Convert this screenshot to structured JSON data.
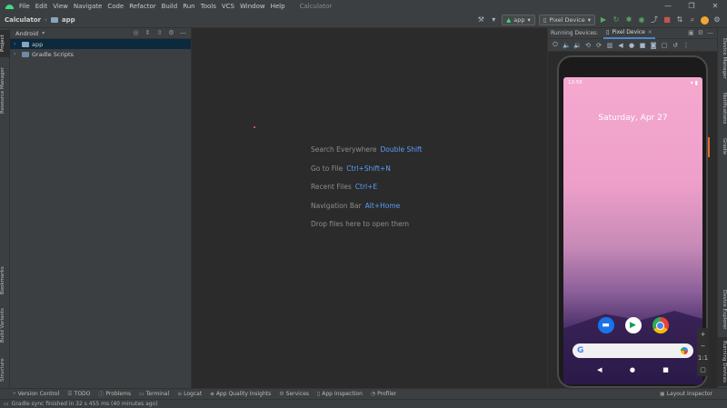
{
  "menu": [
    "File",
    "Edit",
    "View",
    "Navigate",
    "Code",
    "Refactor",
    "Build",
    "Run",
    "Tools",
    "VCS",
    "Window",
    "Help"
  ],
  "window_title": "Calculator",
  "window_controls": [
    "—",
    "❐",
    "✕"
  ],
  "breadcrumb": {
    "project": "Calculator",
    "module": "app"
  },
  "toolbar": {
    "run_config": "app",
    "device": "Pixel Device"
  },
  "project_panel": {
    "view_mode": "Android",
    "tree": [
      {
        "label": "app",
        "selected": true
      },
      {
        "label": "Gradle Scripts",
        "selected": false
      }
    ]
  },
  "left_tabs": [
    "Project",
    "Resource Manager",
    "Bookmarks",
    "Build Variants",
    "Structure"
  ],
  "right_tabs": [
    "Device Manager",
    "Notifications",
    "Gradle",
    "Device Explorer",
    "Running Devices"
  ],
  "editor_hints": [
    {
      "text": "Search Everywhere",
      "key": "Double Shift"
    },
    {
      "text": "Go to File",
      "key": "Ctrl+Shift+N"
    },
    {
      "text": "Recent Files",
      "key": "Ctrl+E"
    },
    {
      "text": "Navigation Bar",
      "key": "Alt+Home"
    },
    {
      "text": "Drop files here to open them",
      "key": ""
    }
  ],
  "running_devices": {
    "label": "Running Devices:",
    "tab": "Pixel Device",
    "phone": {
      "time": "12:56",
      "date": "Saturday, Apr 27",
      "side_zoom": "1:1"
    }
  },
  "bottom_tools": [
    "Version Control",
    "TODO",
    "Problems",
    "Terminal",
    "Logcat",
    "App Quality Insights",
    "Services",
    "App Inspection",
    "Profiler"
  ],
  "layout_inspector": "Layout Inspector",
  "status_message": "Gradle sync finished in 32 s 455 ms (40 minutes ago)"
}
